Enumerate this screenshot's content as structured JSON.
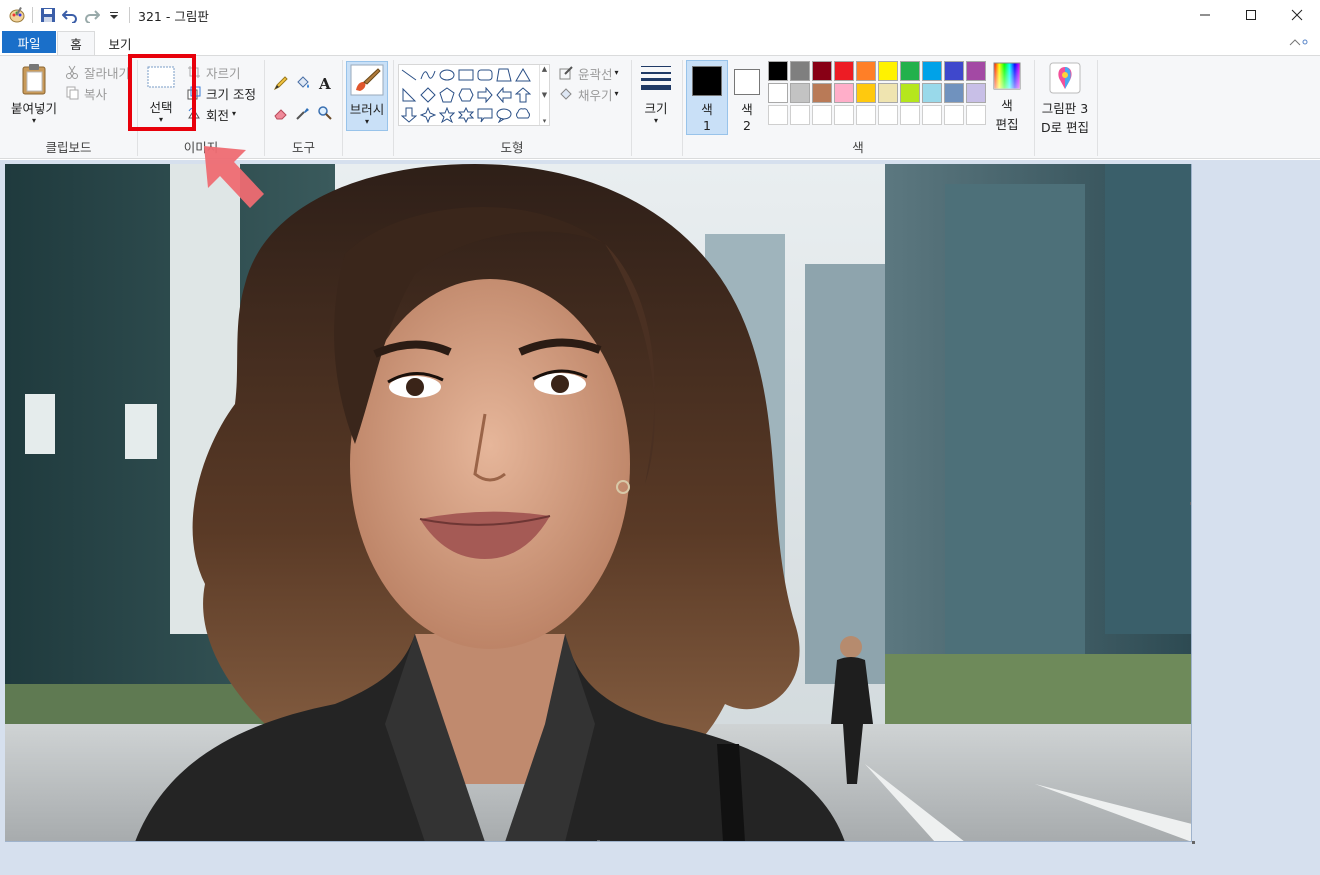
{
  "window": {
    "title": "321 - 그림판",
    "controls": [
      "minimize",
      "maximize",
      "close"
    ]
  },
  "tabs": {
    "file": "파일",
    "home": "홈",
    "view": "보기"
  },
  "clipboard": {
    "group_label": "클립보드",
    "paste": "붙여넣기",
    "cut": "잘라내기",
    "copy": "복사"
  },
  "image": {
    "group_label": "이미지",
    "select": "선택",
    "crop": "자르기",
    "resize": "크기 조정",
    "rotate": "회전"
  },
  "tools": {
    "group_label": "도구",
    "icons": [
      "pencil-icon",
      "fill-icon",
      "text-icon",
      "eraser-icon",
      "color-picker-icon",
      "magnifier-icon"
    ]
  },
  "brushes": {
    "label": "브러시"
  },
  "shapes": {
    "group_label": "도형",
    "outline": "윤곽선",
    "fill": "채우기"
  },
  "size": {
    "label": "크기"
  },
  "colors": {
    "group_label": "색",
    "color1_label_a": "색",
    "color1_label_b": "1",
    "color2_label_a": "색",
    "color2_label_b": "2",
    "color1_value": "#000000",
    "color2_value": "#ffffff",
    "edit_label_a": "색",
    "edit_label_b": "편집",
    "palette": [
      "#000000",
      "#7f7f7f",
      "#880015",
      "#ed1c24",
      "#ff7f27",
      "#fff200",
      "#22b14c",
      "#00a2e8",
      "#3f48cc",
      "#a349a4",
      "#ffffff",
      "#c3c3c3",
      "#b97a57",
      "#ffaec9",
      "#ffc90e",
      "#efe4b0",
      "#b5e61d",
      "#99d9ea",
      "#7092be",
      "#c8bfe7"
    ]
  },
  "paint3d": {
    "label_a": "그림판 3",
    "label_b": "D로 편집"
  },
  "accent": "#1a6fc9",
  "highlight_color": "#e8000b"
}
